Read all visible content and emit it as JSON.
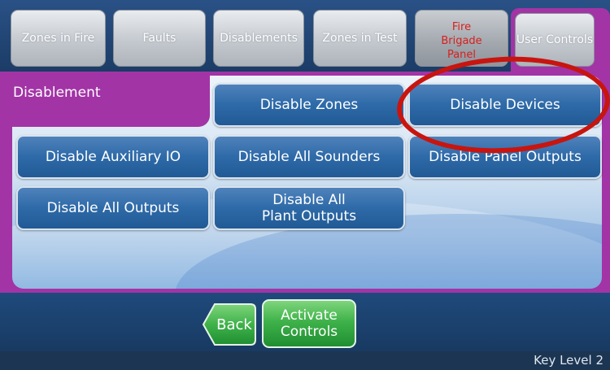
{
  "tabs": [
    {
      "label": "Zones in Fire"
    },
    {
      "label": "Faults"
    },
    {
      "label": "Disablements"
    },
    {
      "label": "Zones in Test"
    },
    {
      "label": "Fire Brigade Panel",
      "color": "#d8201c"
    },
    {
      "label": "User Controls",
      "selected": true
    }
  ],
  "section": {
    "title": "Disablement"
  },
  "buttons": [
    {
      "label": "Disable Zones"
    },
    {
      "label": "Disable Devices",
      "highlighted": true
    },
    {
      "label": "Disable Auxiliary IO"
    },
    {
      "label": "Disable All Sounders"
    },
    {
      "label": "Disable Panel Outputs"
    },
    {
      "label": "Disable All Outputs"
    },
    {
      "label_line1": "Disable All",
      "label_line2": "Plant Outputs"
    }
  ],
  "footer": {
    "back_label": "Back",
    "activate_line1": "Activate",
    "activate_line2": "Controls",
    "key_level": "Key Level 2"
  },
  "colors": {
    "panel_magenta": "#a234a6",
    "button_blue": "#2e6aa8",
    "green": "#3fb24a",
    "annotation_red": "#c8150f",
    "alarm_red": "#d8201c"
  }
}
